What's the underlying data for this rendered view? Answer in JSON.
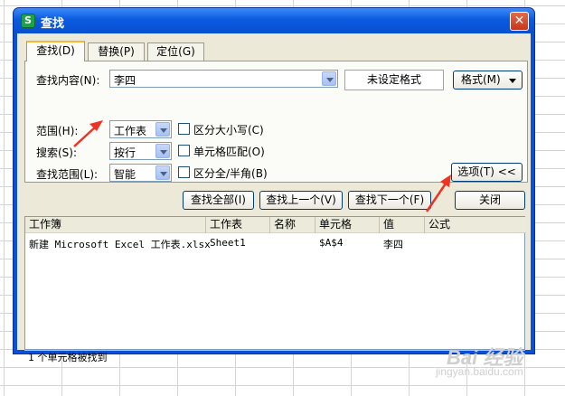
{
  "window": {
    "title": "查找",
    "close_glyph": "✕",
    "app_icon_letter": "S"
  },
  "tabs": [
    {
      "label": "查找(D)",
      "active": true
    },
    {
      "label": "替换(P)",
      "active": false
    },
    {
      "label": "定位(G)",
      "active": false
    }
  ],
  "find": {
    "label": "查找内容(N):",
    "value": "李四",
    "format_status": "未设定格式",
    "format_button": "格式(M)"
  },
  "options": {
    "scope_label": "范围(H):",
    "scope_value": "工作表",
    "search_label": "搜索(S):",
    "search_value": "按行",
    "lookin_label": "查找范围(L):",
    "lookin_value": "智能",
    "match_case_label": "区分大小写(C)",
    "match_cell_label": "单元格匹配(O)",
    "match_width_label": "区分全/半角(B)",
    "options_button": "选项(T) <<"
  },
  "actions": {
    "find_all": "查找全部(I)",
    "find_prev": "查找上一个(V)",
    "find_next": "查找下一个(F)",
    "close": "关闭"
  },
  "results": {
    "columns": [
      "工作簿",
      "工作表",
      "名称",
      "单元格",
      "值",
      "公式"
    ],
    "rows": [
      {
        "workbook": "新建 Microsoft Excel 工作表.xlsx",
        "sheet": "Sheet1",
        "name": "",
        "cell": "$A$4",
        "value": "李四",
        "formula": ""
      }
    ]
  },
  "status_text": "1 个单元格被找到",
  "watermark": {
    "logo": "Bai 经验",
    "url": "jingyan.baidu.com"
  },
  "colors": {
    "title_bar": "#0b5ae0",
    "dialog_bg": "#ece9d8",
    "annotation_arrow": "#ee3322"
  }
}
